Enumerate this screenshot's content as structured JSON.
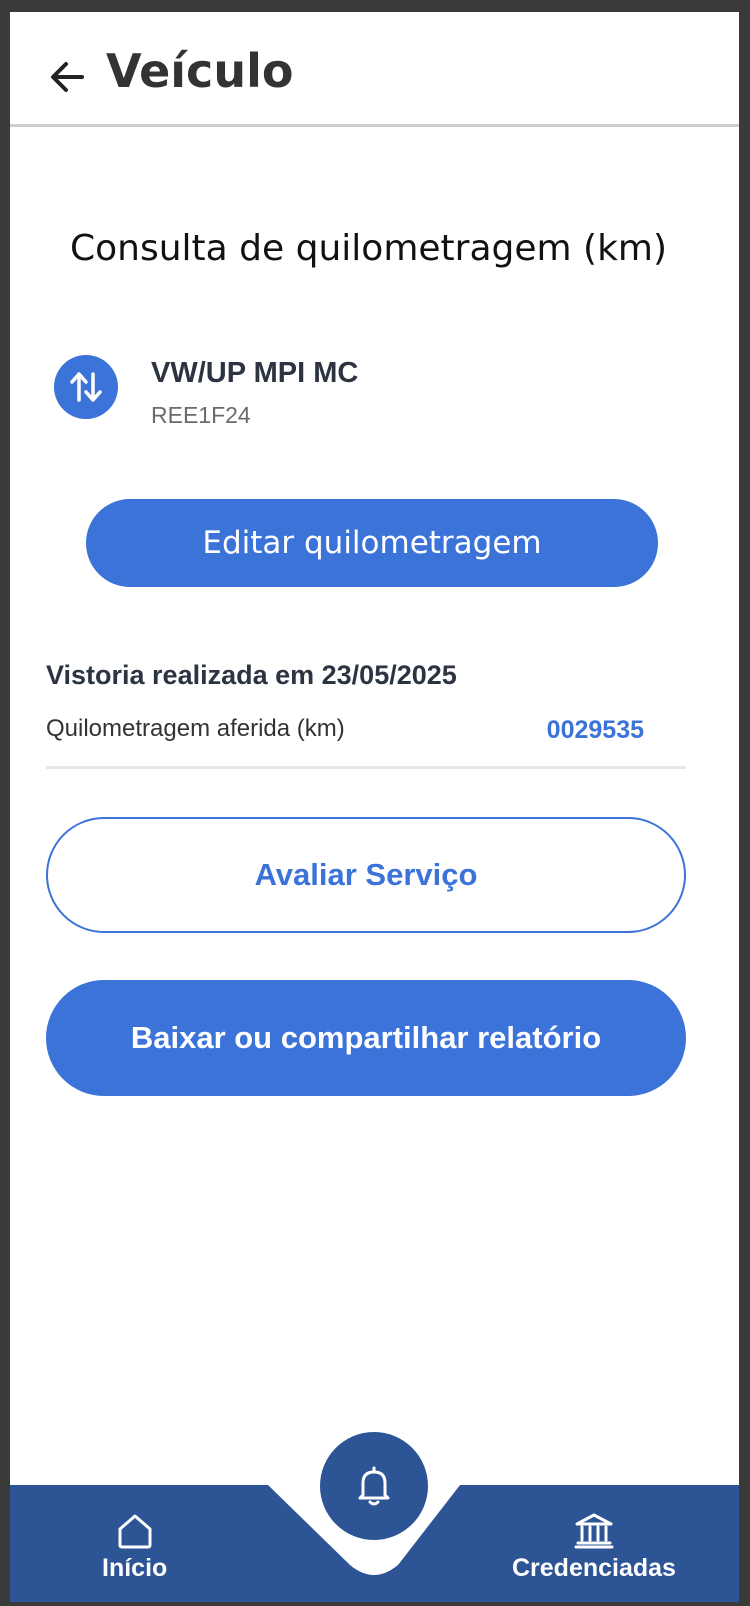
{
  "header": {
    "title": "Veículo"
  },
  "content": {
    "section_title": "Consulta de quilometragem (km)",
    "vehicle": {
      "name": "VW/UP MPI MC",
      "plate": "REE1F24"
    },
    "edit_button_label": "Editar quilometragem",
    "inspection": {
      "title": "Vistoria realizada em 23/05/2025",
      "km_label": "Quilometragem aferida (km)",
      "km_value": "0029535"
    },
    "rate_button_label": "Avaliar Serviço",
    "report_button_label": "Baixar ou compartilhar relatório"
  },
  "bottom_nav": {
    "items": [
      {
        "label": "Início",
        "icon": "home-icon"
      },
      {
        "label": "Credenciadas",
        "icon": "bank-icon"
      }
    ],
    "fab_icon": "bell-icon"
  },
  "colors": {
    "primary": "#3b73d9",
    "nav": "#2d5596",
    "text_dark": "#2c3442"
  }
}
